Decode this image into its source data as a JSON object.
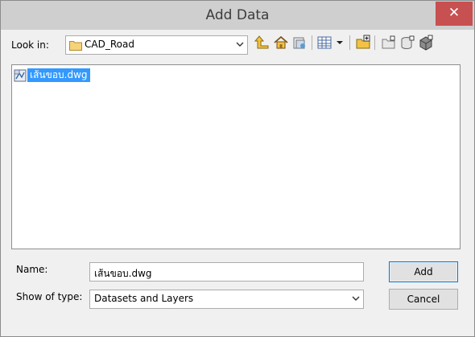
{
  "window": {
    "title": "Add Data",
    "close_label": "✕"
  },
  "toolbar": {
    "look_in_label": "Look in:",
    "look_in_value": "CAD_Road",
    "icons": [
      "up-one-level-icon",
      "home-icon",
      "go-to-folder-icon",
      "view-list-icon",
      "view-options-dropdown-icon",
      "connect-to-folder-icon",
      "new-folder-icon",
      "new-geodatabase-icon",
      "new-shapefile-icon"
    ]
  },
  "file_list": {
    "items": [
      {
        "name": "เส้นขอบ.dwg",
        "icon": "cad-drawing-icon",
        "selected": true
      }
    ]
  },
  "footer": {
    "name_label": "Name:",
    "name_value": "เส้นขอบ.dwg",
    "type_label": "Show of type:",
    "type_value": "Datasets and Layers",
    "add_label": "Add",
    "cancel_label": "Cancel"
  },
  "colors": {
    "selection": "#3399ff",
    "close_button": "#c75050",
    "titlebar": "#cfcfcf"
  }
}
